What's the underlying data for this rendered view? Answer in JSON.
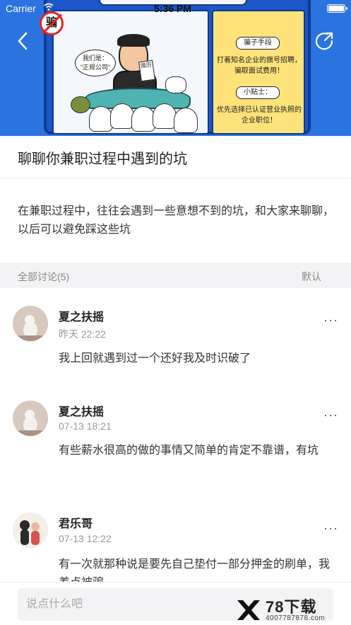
{
  "status_bar": {
    "carrier": "Carrier",
    "time": "5:36 PM",
    "battery_level": 1.0
  },
  "hero": {
    "badge_char": "骗",
    "bubble_text": "我们是：\n“正规公司”",
    "paper_text": "简历",
    "tag1": "骗子手段",
    "text1": "打着知名企业的旗号招聘，骗取面试费用！",
    "tag2": "小贴士：",
    "text2": "优先选择已认证营业执照的企业职位！"
  },
  "nav": {
    "back_icon": "chevron-left-icon",
    "share_icon": "share-icon"
  },
  "topic": {
    "title": "聊聊你兼职过程中遇到的坑",
    "description": "在兼职过程中，往往会遇到一些意想不到的坑，和大家来聊聊，以后可以避免踩这些坑"
  },
  "discussion": {
    "label": "全部讨论(5)",
    "sort": "默认"
  },
  "comments": [
    {
      "name": "夏之扶摇",
      "time": "昨天 22:22",
      "text": "我上回就遇到过一个还好我及时识破了",
      "more": "···"
    },
    {
      "name": "夏之扶摇",
      "time": "07-13 18:21",
      "text": "有些薪水很高的做的事情又简单的肯定不靠谱，有坑",
      "more": "···"
    },
    {
      "name": "君乐哥",
      "time": "07-13 12:22",
      "text": "有一次就那种说是要先自己垫付一部分押金的刷单，我差点被骗",
      "more": "···"
    }
  ],
  "input": {
    "placeholder": "说点什么吧"
  },
  "watermark": {
    "title": "78下载",
    "url": "4007787878.com"
  },
  "colors": {
    "hero_blue": "#2b74e0",
    "section_bg": "#f3f3f5"
  }
}
